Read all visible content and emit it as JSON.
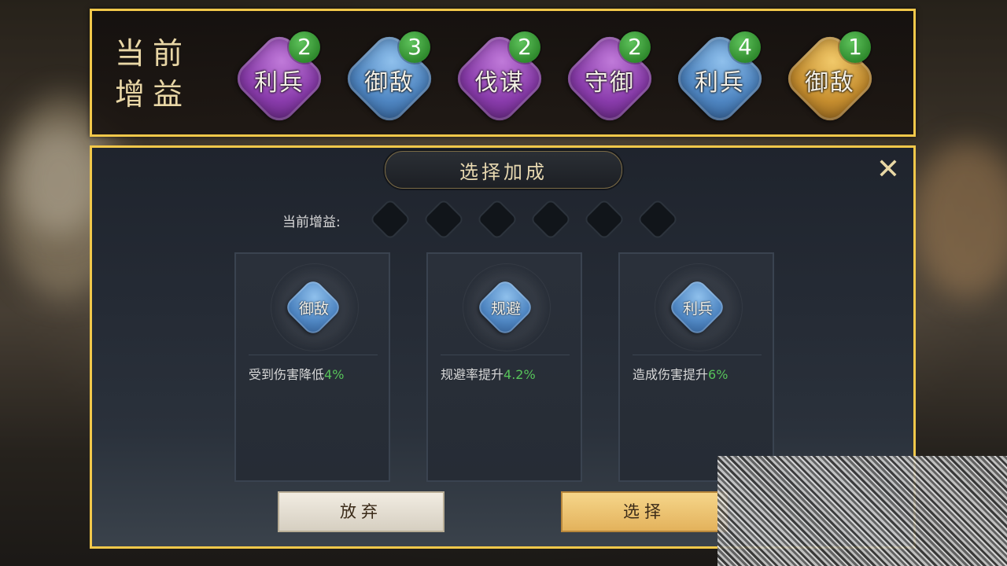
{
  "top_banner": {
    "title": "当前\n增益",
    "badges": [
      {
        "label": "利兵",
        "count": "2",
        "color": "purple"
      },
      {
        "label": "御敌",
        "count": "3",
        "color": "blue"
      },
      {
        "label": "伐谋",
        "count": "2",
        "color": "purple"
      },
      {
        "label": "守御",
        "count": "2",
        "color": "purple"
      },
      {
        "label": "利兵",
        "count": "4",
        "color": "blue"
      },
      {
        "label": "御敌",
        "count": "1",
        "color": "gold"
      }
    ]
  },
  "dialog": {
    "title": "选择加成",
    "close_icon": "✕",
    "current_buffs_label": "当前增益:",
    "empty_slot_count": 6,
    "cards": [
      {
        "icon_label": "御敌",
        "desc_prefix": "受到伤害降低",
        "desc_value": "4%"
      },
      {
        "icon_label": "规避",
        "desc_prefix": "规避率提升",
        "desc_value": "4.2%"
      },
      {
        "icon_label": "利兵",
        "desc_prefix": "造成伤害提升",
        "desc_value": "6%"
      }
    ],
    "buttons": {
      "cancel": "放弃",
      "select": "选择"
    }
  },
  "colors": {
    "frame_gold": "#f2c84a",
    "value_green": "#57c35a",
    "badge_purple": "#8a3cac",
    "badge_blue": "#4f86c2",
    "badge_gold": "#c68e2f"
  }
}
